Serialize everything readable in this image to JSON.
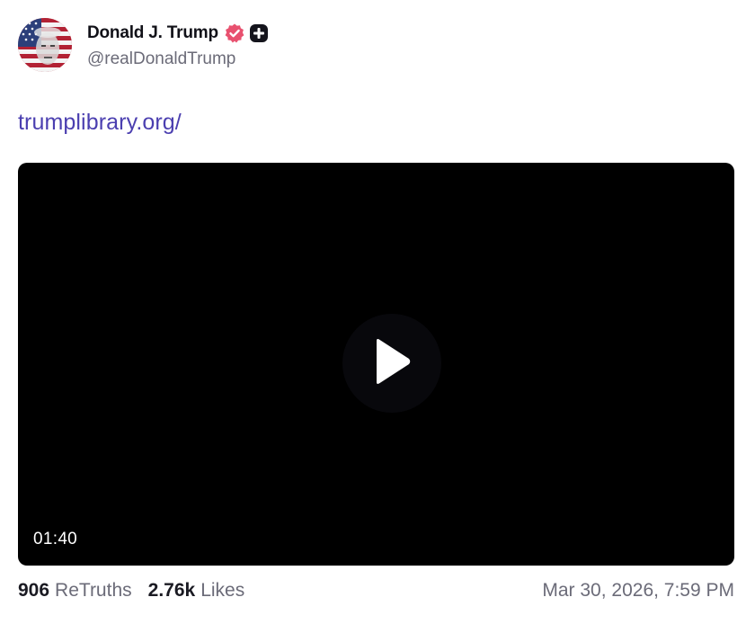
{
  "author": {
    "display_name": "Donald J. Trump",
    "handle": "@realDonaldTrump"
  },
  "post": {
    "link_text": "trumplibrary.org/"
  },
  "video": {
    "duration": "01:40"
  },
  "stats": {
    "retruths_count": "906",
    "retruths_label": "ReTruths",
    "likes_count": "2.76k",
    "likes_label": "Likes",
    "timestamp": "Mar 30, 2026, 7:59 PM"
  },
  "icons": {
    "verified": "verified-badge-icon",
    "plus": "plus-icon",
    "play": "play-icon"
  },
  "colors": {
    "link": "#4b3fb0",
    "verified": "#e8516f",
    "muted_text": "#6b6b78"
  }
}
